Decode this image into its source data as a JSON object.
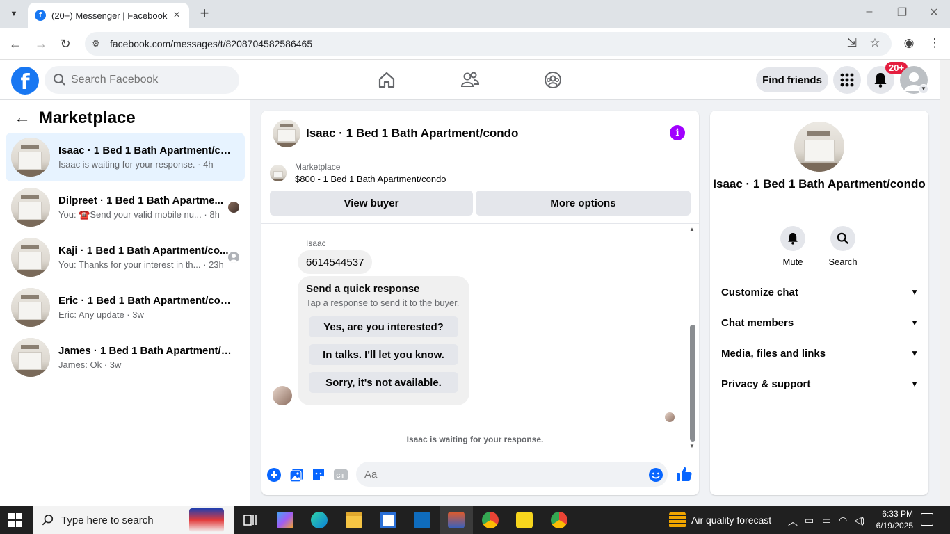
{
  "browser": {
    "tab_title": "(20+) Messenger | Facebook",
    "url": "facebook.com/messages/t/8208704582586465"
  },
  "header": {
    "search_placeholder": "Search Facebook",
    "find_friends": "Find friends",
    "notification_badge": "20+"
  },
  "sidebar": {
    "title": "Marketplace",
    "conversations": [
      {
        "name": "Isaac · 1 Bed 1 Bath Apartment/con...",
        "preview": "Isaac is waiting for your response.",
        "time": "4h"
      },
      {
        "name": "Dilpreet · 1 Bed 1 Bath Apartme...",
        "preview": "You: ☎️Send your valid mobile nu...",
        "time": "8h"
      },
      {
        "name": "Kaji · 1 Bed 1 Bath Apartment/co...",
        "preview": "You: Thanks for your interest in th...",
        "time": "23h"
      },
      {
        "name": "Eric · 1 Bed 1 Bath Apartment/condo",
        "preview": "Eric: Any update",
        "time": "3w"
      },
      {
        "name": "James · 1 Bed 1 Bath Apartment/co...",
        "preview": "James: Ok",
        "time": "3w"
      }
    ]
  },
  "chat": {
    "title": "Isaac · 1 Bed 1 Bath Apartment/condo",
    "listing_source": "Marketplace",
    "listing_title": "$800 - 1 Bed 1 Bath Apartment/condo",
    "view_buyer": "View buyer",
    "more_options": "More options",
    "sender": "Isaac",
    "message": "6614544537",
    "quick_title": "Send a quick response",
    "quick_sub": "Tap a response to send it to the buyer.",
    "quick_responses": [
      "Yes, are you interested?",
      "In talks. I'll let you know.",
      "Sorry, it's not available."
    ],
    "waiting": "Isaac is waiting for your response.",
    "composer_placeholder": "Aa"
  },
  "info": {
    "name": "Isaac · 1 Bed 1 Bath Apartment/condo",
    "mute": "Mute",
    "search": "Search",
    "sections": [
      "Customize chat",
      "Chat members",
      "Media, files and links",
      "Privacy & support"
    ]
  },
  "taskbar": {
    "search_placeholder": "Type here to search",
    "weather": "Air quality forecast",
    "time": "6:33 PM",
    "date": "6/19/2025"
  },
  "colors": {
    "fb_blue": "#1877f2",
    "active_conv": "#e7f3ff",
    "info_icon": "#a100ff",
    "badge": "#e41e3f"
  }
}
